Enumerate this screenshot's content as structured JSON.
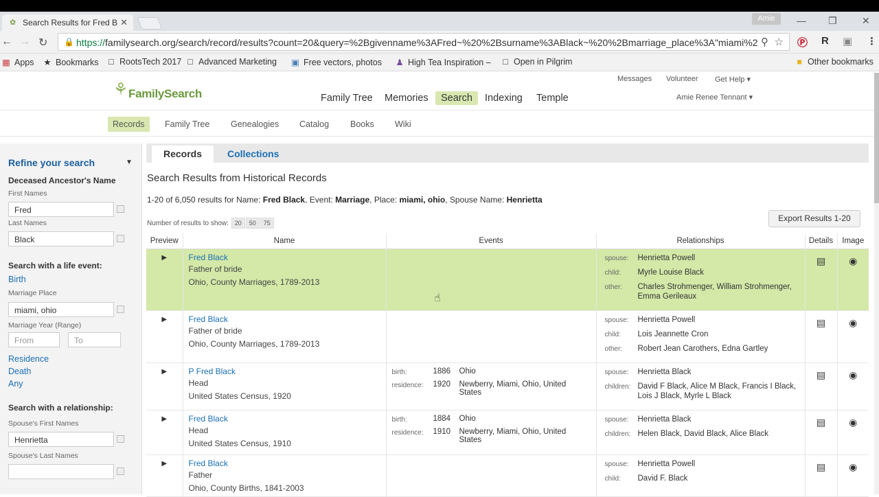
{
  "browser": {
    "tab_title": "Search Results for Fred B",
    "user": "Amie",
    "url_scheme": "https://",
    "url_rest": "familysearch.org/search/record/results?count=20&query=%2Bgivenname%3AFred~%20%2Bsurname%3ABlack~%20%2Bmarriage_place%3A\"miami%2",
    "bookmarks": [
      "Apps",
      "Bookmarks",
      "RootsTech 2017",
      "Advanced Marketing",
      "Free vectors, photos",
      "High Tea Inspiration –",
      "Open in Pilgrim",
      "Other bookmarks"
    ]
  },
  "header": {
    "logo": "FamilySearch",
    "nav": [
      "Family Tree",
      "Memories",
      "Search",
      "Indexing",
      "Temple"
    ],
    "util": [
      "Messages",
      "Volunteer",
      "Get Help ▾"
    ],
    "user": "Amie Renee Tennant ▾"
  },
  "subnav": [
    "Records",
    "Family Tree",
    "Genealogies",
    "Catalog",
    "Books",
    "Wiki"
  ],
  "sidebar": {
    "title": "Refine your search",
    "ancestor_heading": "Deceased Ancestor's Name",
    "first_names_label": "First Names",
    "first_names_value": "Fred",
    "last_names_label": "Last Names",
    "last_names_value": "Black",
    "life_event_heading": "Search with a life event:",
    "birth_link": "Birth",
    "marriage_place_label": "Marriage Place",
    "marriage_place_value": "miami, ohio",
    "marriage_year_label": "Marriage Year (Range)",
    "from_placeholder": "From",
    "to_placeholder": "To",
    "residence_link": "Residence",
    "death_link": "Death",
    "any_link": "Any",
    "relationship_heading": "Search with a relationship:",
    "spouse_first_label": "Spouse's First Names",
    "spouse_first_value": "Henrietta",
    "spouse_last_label": "Spouse's Last Names",
    "spouse_last_value": ""
  },
  "content": {
    "tab_records": "Records",
    "tab_collections": "Collections",
    "heading": "Search Results from Historical Records",
    "summary_prefix": "1-20 of 6,050 results for Name: ",
    "summary_name": "Fred Black",
    "summary_event_label": ", Event: ",
    "summary_event": "Marriage",
    "summary_place_label": ", Place: ",
    "summary_place": "miami, ohio",
    "summary_spouse_label": ", Spouse Name: ",
    "summary_spouse": "Henrietta",
    "num_show_label": "Number of results to show:",
    "page_sizes": [
      "20",
      "50",
      "75"
    ],
    "export_label": "Export Results 1-20",
    "columns": [
      "Preview",
      "Name",
      "Events",
      "Relationships",
      "Details",
      "Image"
    ]
  },
  "results": [
    {
      "name": "Fred Black",
      "role": "Father of bride",
      "collection": "Ohio, County Marriages, 1789-2013",
      "events": [],
      "relationships": [
        {
          "k": "spouse:",
          "v": "Henrietta Powell"
        },
        {
          "k": "child:",
          "v": "Myrle Louise Black"
        },
        {
          "k": "other:",
          "v": "Charles Strohmenger, William Strohmenger, Emma Gerileaux"
        }
      ]
    },
    {
      "name": "Fred Black",
      "role": "Father of bride",
      "collection": "Ohio, County Marriages, 1789-2013",
      "events": [],
      "relationships": [
        {
          "k": "spouse:",
          "v": "Henrietta Powell"
        },
        {
          "k": "child:",
          "v": "Lois Jeannette Cron"
        },
        {
          "k": "other:",
          "v": "Robert Jean Carothers, Edna Gartley"
        }
      ]
    },
    {
      "name": "P Fred Black",
      "role": "Head",
      "collection": "United States Census, 1920",
      "events": [
        {
          "k": "birth:",
          "y": "1886",
          "p": "Ohio"
        },
        {
          "k": "residence:",
          "y": "1920",
          "p": "Newberry, Miami, Ohio, United States"
        }
      ],
      "relationships": [
        {
          "k": "spouse:",
          "v": "Henrietta Black"
        },
        {
          "k": "children:",
          "v": "David F Black, Alice M Black, Francis I Black, Lois J Black, Myrle L Black"
        }
      ]
    },
    {
      "name": "Fred Black",
      "role": "Head",
      "collection": "United States Census, 1910",
      "events": [
        {
          "k": "birth:",
          "y": "1884",
          "p": "Ohio"
        },
        {
          "k": "residence:",
          "y": "1910",
          "p": "Newberry, Miami, Ohio, United States"
        }
      ],
      "relationships": [
        {
          "k": "spouse:",
          "v": "Henrietta Black"
        },
        {
          "k": "children:",
          "v": "Helen Black, David Black, Alice Black"
        }
      ]
    },
    {
      "name": "Fred Black",
      "role": "Father",
      "collection": "Ohio, County Births, 1841-2003",
      "events": [],
      "relationships": [
        {
          "k": "spouse:",
          "v": "Henrietta Powell"
        },
        {
          "k": "child:",
          "v": "David F. Black"
        }
      ]
    }
  ]
}
